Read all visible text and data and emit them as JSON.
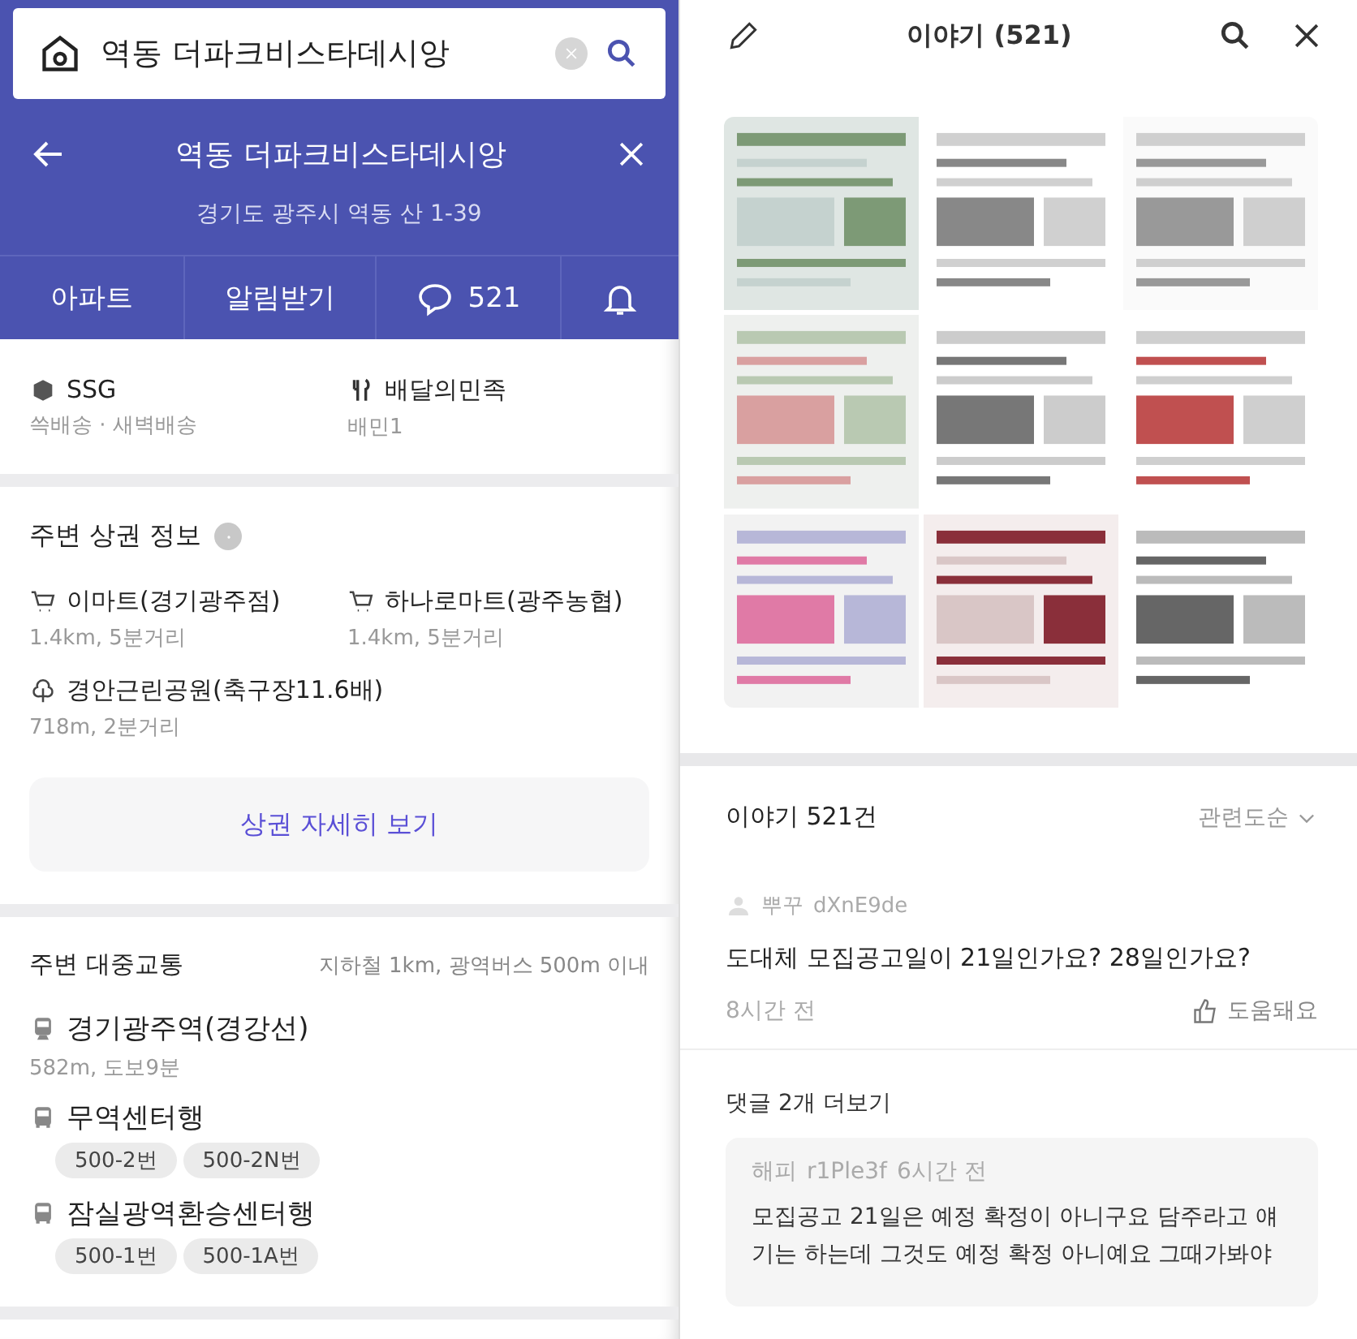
{
  "search": {
    "value": "역동 더파크비스타데시앙"
  },
  "header": {
    "title": "역동 더파크비스타데시앙",
    "address": "경기도 광주시 역동 산 1-39"
  },
  "tabs": [
    {
      "kind": "text",
      "label": "아파트"
    },
    {
      "kind": "text",
      "label": "알림받기"
    },
    {
      "kind": "comments",
      "label": "521"
    },
    {
      "kind": "bell"
    }
  ],
  "delivery": [
    {
      "kind": "box",
      "name": "SSG",
      "detail": "쓱배송 · 새벽배송"
    },
    {
      "kind": "food",
      "name": "배달의민족",
      "detail": "배민1"
    }
  ],
  "commerce": {
    "title": "주변 상권 정보",
    "places": [
      {
        "kind": "cart",
        "name": "이마트(경기광주점)",
        "distance": "1.4km, 5분거리"
      },
      {
        "kind": "cart",
        "name": "하나로마트(광주농협)",
        "distance": "1.4km, 5분거리"
      },
      {
        "kind": "park",
        "name": "경안근린공원(축구장11.6배)",
        "distance": "718m, 2분거리"
      }
    ],
    "button": "상권 자세히 보기"
  },
  "transit": {
    "title": "주변 대중교통",
    "note": "지하철 1km, 광역버스 500m 이내",
    "items": [
      {
        "kind": "train",
        "name": "경기광주역(경강선)",
        "detail": "582m, 도보9분"
      },
      {
        "kind": "bus",
        "name": "무역센터행",
        "routes": [
          "500-2번",
          "500-2N번"
        ]
      },
      {
        "kind": "bus",
        "name": "잠실광역환승센터행",
        "routes": [
          "500-1번",
          "500-1A번"
        ]
      }
    ]
  },
  "story_panel": {
    "title": "이야기 (521)",
    "count_label": "이야기 521건",
    "sort": "관련도순",
    "post": {
      "nickname": "뿌꾸",
      "user_id": "dXnE9de",
      "text": "도대체 모집공고일이 21일인가요? 28일인가요?",
      "time": "8시간 전",
      "like": "도움돼요"
    },
    "more_comments": "댓글 2개 더보기",
    "comment": {
      "nickname": "해피",
      "user_id": "r1Ple3f",
      "time": "6시간 전",
      "text": "모집공고 21일은 예정 확정이 아니구요 담주라고 얘기는 하는데 그것도 예정 확정 아니예요  그때가봐야"
    }
  }
}
